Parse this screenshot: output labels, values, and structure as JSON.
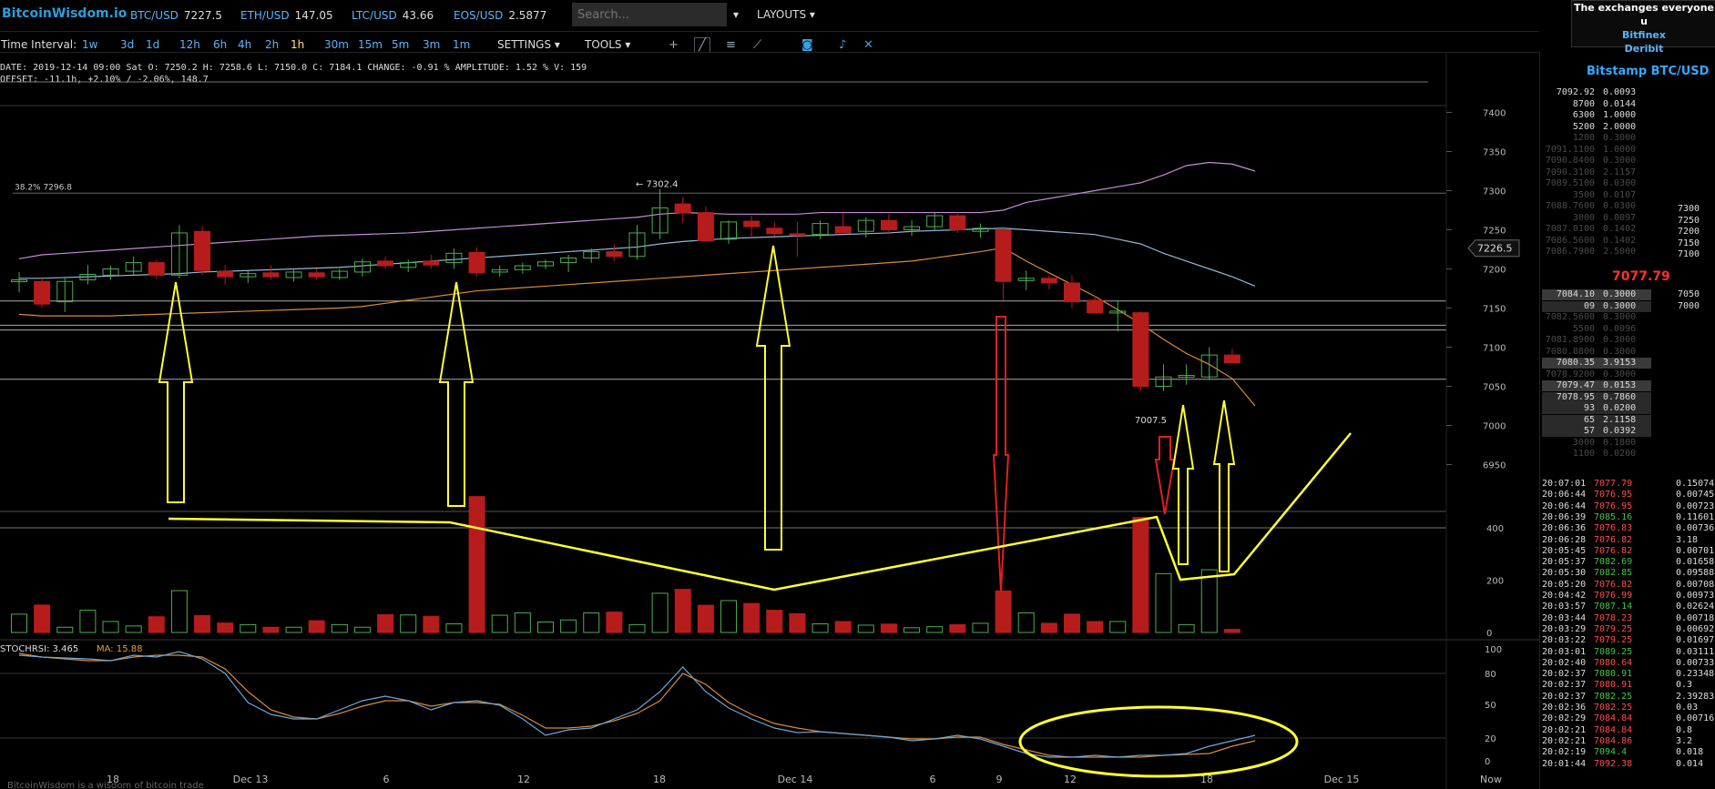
{
  "header": {
    "brand": "BitcoinWisdom.io",
    "tickers": [
      {
        "pair": "BTC/USD",
        "price": "7227.5"
      },
      {
        "pair": "ETH/USD",
        "price": "147.05"
      },
      {
        "pair": "LTC/USD",
        "price": "43.66"
      },
      {
        "pair": "EOS/USD",
        "price": "2.5877"
      }
    ],
    "search_placeholder": "Search...",
    "layouts_label": "LAYOUTS",
    "promo": {
      "headline": "The exchanges everyone u",
      "links": [
        "Bitfinex",
        "Deribit"
      ]
    }
  },
  "toolbar": {
    "interval_label": "Time Interval:",
    "intervals": [
      "1w",
      "3d",
      "1d",
      "12h",
      "6h",
      "4h",
      "2h",
      "1h",
      "30m",
      "15m",
      "5m",
      "3m",
      "1m"
    ],
    "selected_interval": "1h",
    "settings_label": "SETTINGS",
    "tools_label": "TOOLS"
  },
  "info": {
    "line1": "DATE: 2019-12-14 09:00 Sat    O: 7250.2    H: 7258.6    L: 7150.0    C: 7184.1    CHANGE:  -0.91 %    AMPLITUDE: 1.52 %    V: 159",
    "line2": "OFFSET: -11.1h, +2.10% / -2.06%, 148.7"
  },
  "chart_labels": {
    "fib_label": "38.2% 7296.8",
    "high_label": "← 7302.4",
    "price_box": "7226.5",
    "level_label": "7007.5",
    "stoch_label": "STOCHRSI: 3.465",
    "ma_label": "MA: 15.88",
    "x_ticks": [
      "18",
      "Dec 13",
      "6",
      "12",
      "18",
      "Dec 14",
      "6",
      "9",
      "12",
      "18",
      "Dec 15",
      "Now"
    ],
    "price_ticks": [
      "7400",
      "7350",
      "7300",
      "7250",
      "7200",
      "7150",
      "7100",
      "7050",
      "7000",
      "6950"
    ],
    "vol_ticks": [
      "400",
      "200",
      "0"
    ],
    "stoch_ticks": [
      "100",
      "80",
      "50",
      "20",
      "0"
    ],
    "footer_text": "BitcoinWisdom is a wisdom of bitcoin trade"
  },
  "chart_data": {
    "type": "candlestick",
    "title": "",
    "xlabel": "",
    "ylabel": "",
    "ylim": [
      6925,
      7425
    ],
    "volume_ylim": [
      0,
      470
    ],
    "colors": {
      "up": "#4cae4c",
      "down": "#b71c1c",
      "bb": "#c58bd8",
      "bb_mid": "#8fb9d6",
      "ma_slow": "#d98b3a",
      "annotation": "#ffff33"
    },
    "candles": [
      {
        "o": 7184,
        "h": 7196,
        "l": 7170,
        "c": 7186,
        "v": 70
      },
      {
        "o": 7184,
        "h": 7188,
        "l": 7150,
        "c": 7155,
        "v": 105
      },
      {
        "o": 7158,
        "h": 7188,
        "l": 7145,
        "c": 7184,
        "v": 20
      },
      {
        "o": 7186,
        "h": 7205,
        "l": 7180,
        "c": 7193,
        "v": 85
      },
      {
        "o": 7192,
        "h": 7204,
        "l": 7186,
        "c": 7200,
        "v": 42
      },
      {
        "o": 7197,
        "h": 7216,
        "l": 7192,
        "c": 7208,
        "v": 25
      },
      {
        "o": 7208,
        "h": 7212,
        "l": 7187,
        "c": 7192,
        "v": 60
      },
      {
        "o": 7192,
        "h": 7256,
        "l": 7188,
        "c": 7246,
        "v": 160
      },
      {
        "o": 7248,
        "h": 7255,
        "l": 7192,
        "c": 7198,
        "v": 65
      },
      {
        "o": 7197,
        "h": 7205,
        "l": 7180,
        "c": 7190,
        "v": 36
      },
      {
        "o": 7190,
        "h": 7198,
        "l": 7182,
        "c": 7194,
        "v": 30
      },
      {
        "o": 7195,
        "h": 7205,
        "l": 7186,
        "c": 7190,
        "v": 20
      },
      {
        "o": 7189,
        "h": 7201,
        "l": 7184,
        "c": 7196,
        "v": 20
      },
      {
        "o": 7195,
        "h": 7200,
        "l": 7186,
        "c": 7190,
        "v": 45
      },
      {
        "o": 7189,
        "h": 7200,
        "l": 7186,
        "c": 7197,
        "v": 30
      },
      {
        "o": 7196,
        "h": 7213,
        "l": 7190,
        "c": 7209,
        "v": 20
      },
      {
        "o": 7210,
        "h": 7216,
        "l": 7200,
        "c": 7204,
        "v": 68
      },
      {
        "o": 7202,
        "h": 7212,
        "l": 7196,
        "c": 7208,
        "v": 67
      },
      {
        "o": 7210,
        "h": 7218,
        "l": 7200,
        "c": 7205,
        "v": 62
      },
      {
        "o": 7208,
        "h": 7226,
        "l": 7200,
        "c": 7220,
        "v": 33
      },
      {
        "o": 7221,
        "h": 7228,
        "l": 7190,
        "c": 7195,
        "v": 520
      },
      {
        "o": 7196,
        "h": 7204,
        "l": 7190,
        "c": 7199,
        "v": 66
      },
      {
        "o": 7199,
        "h": 7208,
        "l": 7194,
        "c": 7204,
        "v": 75
      },
      {
        "o": 7204,
        "h": 7212,
        "l": 7200,
        "c": 7209,
        "v": 40
      },
      {
        "o": 7208,
        "h": 7218,
        "l": 7196,
        "c": 7214,
        "v": 48
      },
      {
        "o": 7214,
        "h": 7226,
        "l": 7208,
        "c": 7222,
        "v": 75
      },
      {
        "o": 7222,
        "h": 7232,
        "l": 7210,
        "c": 7216,
        "v": 78
      },
      {
        "o": 7216,
        "h": 7256,
        "l": 7212,
        "c": 7246,
        "v": 30
      },
      {
        "o": 7246,
        "h": 7302,
        "l": 7238,
        "c": 7278,
        "v": 150
      },
      {
        "o": 7283,
        "h": 7292,
        "l": 7258,
        "c": 7272,
        "v": 165
      },
      {
        "o": 7272,
        "h": 7280,
        "l": 7236,
        "c": 7236,
        "v": 104
      },
      {
        "o": 7238,
        "h": 7262,
        "l": 7232,
        "c": 7260,
        "v": 122
      },
      {
        "o": 7261,
        "h": 7268,
        "l": 7240,
        "c": 7254,
        "v": 111
      },
      {
        "o": 7252,
        "h": 7260,
        "l": 7242,
        "c": 7245,
        "v": 85
      },
      {
        "o": 7245,
        "h": 7260,
        "l": 7216,
        "c": 7243,
        "v": 72
      },
      {
        "o": 7244,
        "h": 7262,
        "l": 7238,
        "c": 7258,
        "v": 33
      },
      {
        "o": 7254,
        "h": 7272,
        "l": 7248,
        "c": 7246,
        "v": 42
      },
      {
        "o": 7248,
        "h": 7266,
        "l": 7240,
        "c": 7262,
        "v": 28
      },
      {
        "o": 7262,
        "h": 7270,
        "l": 7246,
        "c": 7250,
        "v": 32
      },
      {
        "o": 7250,
        "h": 7262,
        "l": 7242,
        "c": 7254,
        "v": 18
      },
      {
        "o": 7254,
        "h": 7272,
        "l": 7248,
        "c": 7268,
        "v": 22
      },
      {
        "o": 7268,
        "h": 7272,
        "l": 7246,
        "c": 7250,
        "v": 30
      },
      {
        "o": 7248,
        "h": 7258,
        "l": 7240,
        "c": 7252,
        "v": 35
      },
      {
        "o": 7250,
        "h": 7254,
        "l": 7160,
        "c": 7184,
        "v": 159
      },
      {
        "o": 7185,
        "h": 7198,
        "l": 7173,
        "c": 7188,
        "v": 75
      },
      {
        "o": 7188,
        "h": 7192,
        "l": 7174,
        "c": 7182,
        "v": 35
      },
      {
        "o": 7182,
        "h": 7192,
        "l": 7150,
        "c": 7158,
        "v": 70
      },
      {
        "o": 7160,
        "h": 7166,
        "l": 7148,
        "c": 7144,
        "v": 42
      },
      {
        "o": 7144,
        "h": 7160,
        "l": 7120,
        "c": 7146,
        "v": 42
      },
      {
        "o": 7144,
        "h": 7146,
        "l": 7044,
        "c": 7050,
        "v": 440
      },
      {
        "o": 7050,
        "h": 7078,
        "l": 7044,
        "c": 7062,
        "v": 225
      },
      {
        "o": 7062,
        "h": 7078,
        "l": 7052,
        "c": 7064,
        "v": 30
      },
      {
        "o": 7062,
        "h": 7100,
        "l": 7058,
        "c": 7090,
        "v": 240
      },
      {
        "o": 7090,
        "h": 7098,
        "l": 7080,
        "c": 7080,
        "v": 12
      }
    ],
    "bollinger_upper": [
      7213,
      7218,
      7220,
      7222,
      7224,
      7226,
      7228,
      7230,
      7232,
      7234,
      7236,
      7238,
      7240,
      7242,
      7243,
      7244,
      7245,
      7246,
      7248,
      7250,
      7252,
      7254,
      7256,
      7258,
      7260,
      7262,
      7264,
      7266,
      7270,
      7272,
      7271,
      7270,
      7270,
      7270,
      7270,
      7272,
      7272,
      7272,
      7272,
      7272,
      7272,
      7272,
      7272,
      7275,
      7285,
      7290,
      7295,
      7300,
      7305,
      7310,
      7320,
      7332,
      7336,
      7334,
      7325
    ],
    "bollinger_mid": [
      7188,
      7188,
      7189,
      7190,
      7191,
      7192,
      7193,
      7194,
      7196,
      7197,
      7198,
      7199,
      7200,
      7201,
      7202,
      7204,
      7206,
      7208,
      7210,
      7212,
      7214,
      7216,
      7218,
      7220,
      7222,
      7224,
      7226,
      7228,
      7232,
      7235,
      7237,
      7239,
      7240,
      7241,
      7242,
      7243,
      7244,
      7245,
      7246,
      7248,
      7249,
      7250,
      7251,
      7252,
      7250,
      7248,
      7246,
      7244,
      7238,
      7232,
      7220,
      7210,
      7200,
      7190,
      7178
    ],
    "ma_slow": [
      7142,
      7140,
      7140,
      7140,
      7140,
      7141,
      7142,
      7143,
      7144,
      7145,
      7146,
      7147,
      7148,
      7149,
      7150,
      7152,
      7156,
      7160,
      7164,
      7168,
      7172,
      7174,
      7176,
      7178,
      7180,
      7182,
      7184,
      7186,
      7188,
      7190,
      7192,
      7194,
      7196,
      7198,
      7200,
      7202,
      7204,
      7206,
      7208,
      7210,
      7214,
      7218,
      7222,
      7227,
      7210,
      7195,
      7180,
      7165,
      7148,
      7130,
      7110,
      7092,
      7078,
      7060,
      7025
    ],
    "stochrsi": {
      "value": 3.465,
      "ma": 15.88
    },
    "x_labels": [
      "18",
      "Dec 13",
      "6",
      "12",
      "18",
      "Dec 14",
      "6",
      "9",
      "12",
      "18",
      "Dec 15",
      "Now"
    ]
  },
  "orderbook": {
    "title": "Bitstamp BTC/USD",
    "last_price": "7077.79",
    "asks": [
      {
        "price": "7092.92",
        "amount": "0.0093"
      },
      {
        "price": "8700",
        "amount": "0.0144"
      },
      {
        "price": "6300",
        "amount": "1.0000"
      },
      {
        "price": "5200",
        "amount": "2.0000"
      },
      {
        "price": "1200",
        "amount": "0.3000"
      },
      {
        "price": "7091.1100",
        "amount": "1.0000"
      },
      {
        "price": "7090.8400",
        "amount": "0.3000"
      },
      {
        "price": "7090.3100",
        "amount": "2.1157"
      },
      {
        "price": "7089.5100",
        "amount": "0.0300"
      },
      {
        "price": "3500",
        "amount": "0.0107"
      },
      {
        "price": "7088.7600",
        "amount": "0.0300"
      },
      {
        "price": "3000",
        "amount": "0.0097"
      },
      {
        "price": "7087.0100",
        "amount": "0.1402"
      },
      {
        "price": "7086.5600",
        "amount": "0.1402"
      },
      {
        "price": "7086.7900",
        "amount": "2.5000"
      }
    ],
    "ask_axis": [
      "7300",
      "7250",
      "7200",
      "7150",
      "7100"
    ],
    "bids": [
      {
        "price": "7084.10",
        "amount": "0.3000"
      },
      {
        "price": "09",
        "amount": "0.3000"
      },
      {
        "price": "7082.5600",
        "amount": "0.3000"
      },
      {
        "price": "5500",
        "amount": "0.0096"
      },
      {
        "price": "7081.8900",
        "amount": "0.3000"
      },
      {
        "price": "7080.8800",
        "amount": "0.3000"
      },
      {
        "price": "7080.35",
        "amount": "3.9153"
      },
      {
        "price": "7078.9200",
        "amount": "0.3000"
      },
      {
        "price": "7079.47",
        "amount": "0.0153"
      },
      {
        "price": "7078.95",
        "amount": "0.7860"
      },
      {
        "price": "93",
        "amount": "0.0200"
      },
      {
        "price": "65",
        "amount": "2.1158"
      },
      {
        "price": "57",
        "amount": "0.0392"
      },
      {
        "price": "3000",
        "amount": "0.1800"
      },
      {
        "price": "1100",
        "amount": "0.0200"
      }
    ],
    "bid_axis": [
      "7050",
      "7000"
    ],
    "trades": [
      {
        "time": "20:07:01",
        "price": "7077.79",
        "amount": "0.15074",
        "dir": "down"
      },
      {
        "time": "20:06:44",
        "price": "7076.95",
        "amount": "0.00745",
        "dir": "down"
      },
      {
        "time": "20:06:44",
        "price": "7076.95",
        "amount": "0.00723",
        "dir": "down"
      },
      {
        "time": "20:06:39",
        "price": "7085.16",
        "amount": "0.11601",
        "dir": "up"
      },
      {
        "time": "20:06:36",
        "price": "7076.83",
        "amount": "0.00736",
        "dir": "down"
      },
      {
        "time": "20:06:28",
        "price": "7076.82",
        "amount": "3.18",
        "dir": "down"
      },
      {
        "time": "20:05:45",
        "price": "7076.82",
        "amount": "0.00701",
        "dir": "down"
      },
      {
        "time": "20:05:37",
        "price": "7082.69",
        "amount": "0.01658",
        "dir": "up"
      },
      {
        "time": "20:05:30",
        "price": "7082.85",
        "amount": "0.09588",
        "dir": "up"
      },
      {
        "time": "20:05:20",
        "price": "7076.82",
        "amount": "0.00708",
        "dir": "down"
      },
      {
        "time": "20:04:42",
        "price": "7076.99",
        "amount": "0.00973",
        "dir": "down"
      },
      {
        "time": "20:03:57",
        "price": "7087.14",
        "amount": "0.02624",
        "dir": "up"
      },
      {
        "time": "20:03:44",
        "price": "7078.23",
        "amount": "0.00718",
        "dir": "down"
      },
      {
        "time": "20:03:29",
        "price": "7079.25",
        "amount": "0.00692",
        "dir": "down"
      },
      {
        "time": "20:03:22",
        "price": "7079.25",
        "amount": "0.01697",
        "dir": "down"
      },
      {
        "time": "20:03:01",
        "price": "7089.25",
        "amount": "0.03111",
        "dir": "up"
      },
      {
        "time": "20:02:40",
        "price": "7080.64",
        "amount": "0.00733",
        "dir": "down"
      },
      {
        "time": "20:02:37",
        "price": "7080.91",
        "amount": "0.23348",
        "dir": "up"
      },
      {
        "time": "20:02:37",
        "price": "7080.91",
        "amount": "0.3",
        "dir": "down"
      },
      {
        "time": "20:02:37",
        "price": "7082.25",
        "amount": "2.39283",
        "dir": "up"
      },
      {
        "time": "20:02:36",
        "price": "7082.25",
        "amount": "0.03",
        "dir": "down"
      },
      {
        "time": "20:02:29",
        "price": "7084.84",
        "amount": "0.00716",
        "dir": "down"
      },
      {
        "time": "20:02:21",
        "price": "7084.84",
        "amount": "0.8",
        "dir": "down"
      },
      {
        "time": "20:02:21",
        "price": "7084.86",
        "amount": "3.2",
        "dir": "down"
      },
      {
        "time": "20:02:19",
        "price": "7094.4",
        "amount": "0.018",
        "dir": "up"
      },
      {
        "time": "20:01:44",
        "price": "7092.38",
        "amount": "0.014",
        "dir": "down"
      }
    ]
  }
}
